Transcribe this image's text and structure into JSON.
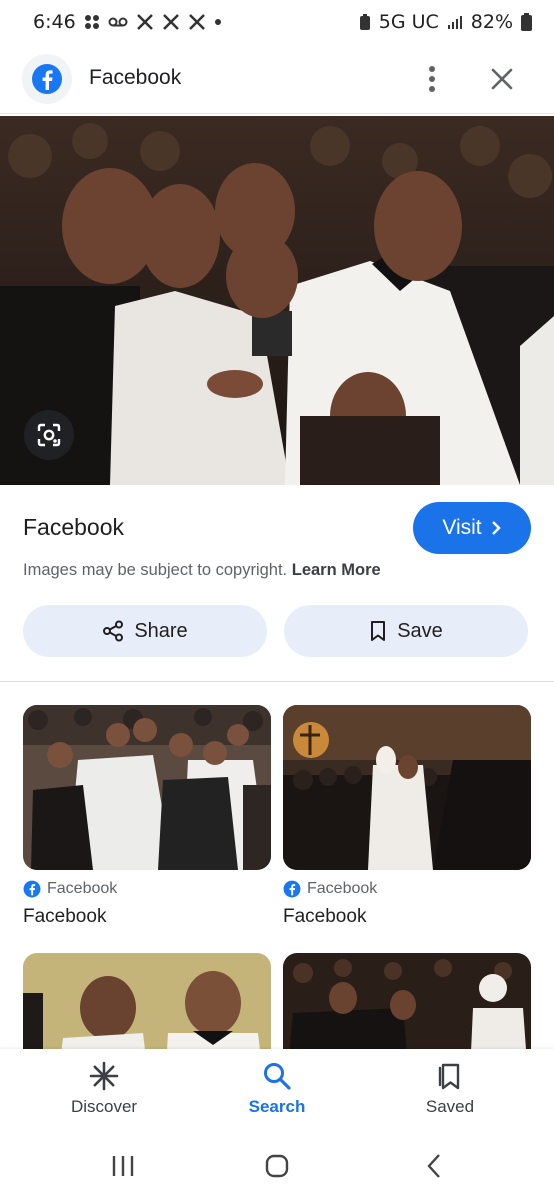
{
  "status_bar": {
    "time": "6:46",
    "network": "5G UC",
    "battery": "82%",
    "icons": [
      "grid-icon",
      "voicemail-icon",
      "x-icon",
      "x-icon",
      "x-icon",
      "dot-icon"
    ]
  },
  "header": {
    "title": "Facebook",
    "icons": [
      "facebook-icon",
      "more-vert-icon",
      "close-icon"
    ]
  },
  "hero": {
    "lens_icon": "google-lens-icon"
  },
  "info": {
    "source_title": "Facebook",
    "visit_label": "Visit",
    "copyright_text": "Images may be subject to copyright.",
    "learn_more_label": "Learn More",
    "share_label": "Share",
    "save_label": "Save"
  },
  "results": [
    {
      "source": "Facebook",
      "title": "Facebook"
    },
    {
      "source": "Facebook",
      "title": "Facebook"
    },
    {
      "source": "",
      "title": ""
    },
    {
      "source": "",
      "title": ""
    }
  ],
  "bottom_nav": {
    "items": [
      {
        "label": "Discover",
        "icon": "asterisk-icon",
        "active": false
      },
      {
        "label": "Search",
        "icon": "search-icon",
        "active": true
      },
      {
        "label": "Saved",
        "icon": "saved-icon",
        "active": false
      }
    ]
  },
  "colors": {
    "accent": "#1a73e8",
    "facebook_blue": "#1877f2",
    "chip_bg": "#e8eef9"
  }
}
